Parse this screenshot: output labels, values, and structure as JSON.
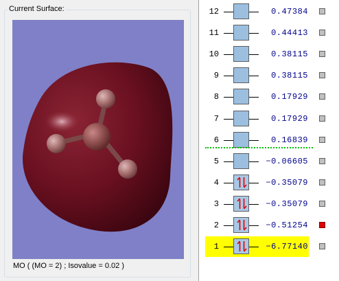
{
  "surface_panel": {
    "legend": "Current Surface:",
    "status": "MO ( (MO = 2) ; Isovalue = 0.02 )"
  },
  "colors": {
    "background": "#8080c8",
    "isosurface": "#6e1020",
    "atom": "#b07a7a",
    "highlight": "#ffff00",
    "selected_square": "#e00000",
    "homo_lumo_separator": "#00c000",
    "energy_text": "#00008b",
    "electron_arrow": "#e00000"
  },
  "mo_list": {
    "rows": [
      {
        "num": "12",
        "energy": "0.47384",
        "electrons": 0,
        "selected": false,
        "highlight": false
      },
      {
        "num": "11",
        "energy": "0.44413",
        "electrons": 0,
        "selected": false,
        "highlight": false
      },
      {
        "num": "10",
        "energy": "0.38115",
        "electrons": 0,
        "selected": false,
        "highlight": false
      },
      {
        "num": "9",
        "energy": "0.38115",
        "electrons": 0,
        "selected": false,
        "highlight": false
      },
      {
        "num": "8",
        "energy": "0.17929",
        "electrons": 0,
        "selected": false,
        "highlight": false
      },
      {
        "num": "7",
        "energy": "0.17929",
        "electrons": 0,
        "selected": false,
        "highlight": false
      },
      {
        "num": "6",
        "energy": "0.16839",
        "electrons": 0,
        "selected": false,
        "highlight": false
      },
      {
        "num": "5",
        "energy": "−0.06605",
        "electrons": 0,
        "selected": false,
        "highlight": false
      },
      {
        "num": "4",
        "energy": "−0.35079",
        "electrons": 2,
        "selected": false,
        "highlight": false
      },
      {
        "num": "3",
        "energy": "−0.35079",
        "electrons": 2,
        "selected": false,
        "highlight": false
      },
      {
        "num": "2",
        "energy": "−0.51254",
        "electrons": 2,
        "selected": true,
        "highlight": false
      },
      {
        "num": "1",
        "energy": "−6.77140",
        "electrons": 2,
        "selected": false,
        "highlight": true
      }
    ]
  }
}
